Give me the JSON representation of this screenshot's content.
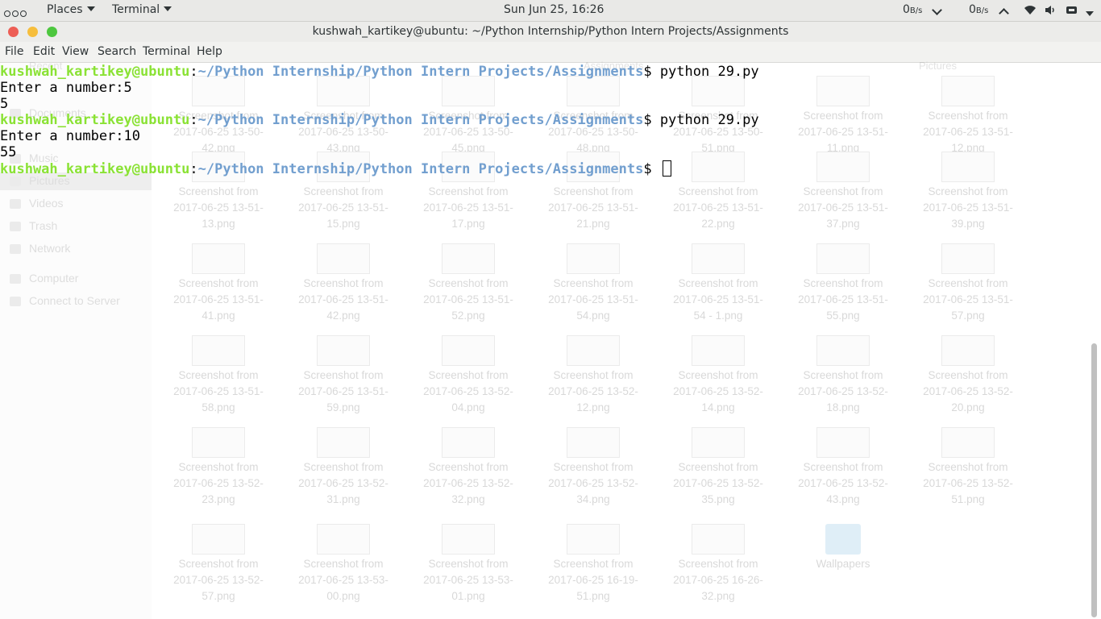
{
  "topbar": {
    "places_label": "Places",
    "terminal_label": "Terminal",
    "clock": "Sun Jun 25, 16:26",
    "net_down": "0",
    "net_down_unit": "B/s",
    "net_up": "0",
    "net_up_unit": "B/s"
  },
  "window": {
    "title": "kushwah_kartikey@ubuntu: ~/Python Internship/Python Intern Projects/Assignments"
  },
  "menu": [
    "File",
    "Edit",
    "View",
    "Search",
    "Terminal",
    "Help"
  ],
  "terminal": {
    "user": "kushwah_kartikey@ubuntu",
    "sep": ":",
    "path": "~/Python Internship/Python Intern Projects/Assignments",
    "prompt_suffix": "$ ",
    "lines": [
      {
        "type": "prompt",
        "cmd": "python 29.py"
      },
      {
        "type": "out",
        "text": "Enter a number:5"
      },
      {
        "type": "out",
        "text": "5"
      },
      {
        "type": "prompt",
        "cmd": "python 29.py"
      },
      {
        "type": "out",
        "text": "Enter a number:10"
      },
      {
        "type": "out",
        "text": "55"
      },
      {
        "type": "prompt",
        "cmd": ""
      }
    ]
  },
  "background_window": {
    "tabs": [
      "Recent",
      "Assignments",
      "Pictures"
    ],
    "sidebar": [
      "Documents",
      "Music",
      "Pictures",
      "Videos",
      "Trash",
      "Network",
      "Computer",
      "Connect to Server"
    ],
    "files": [
      [
        "Screenshot from",
        "2017-06-25 13-50-",
        "42.png"
      ],
      [
        "Screenshot from",
        "2017-06-25 13-50-",
        "43.png"
      ],
      [
        "Screenshot from",
        "2017-06-25 13-50-",
        "45.png"
      ],
      [
        "Screenshot from",
        "2017-06-25 13-50-",
        "48.png"
      ],
      [
        "Screenshot from",
        "2017-06-25 13-50-",
        "51.png"
      ],
      [
        "Screenshot from",
        "2017-06-25 13-51-",
        "11.png"
      ],
      [
        "Screenshot from",
        "2017-06-25 13-51-",
        "12.png"
      ],
      [
        "Screenshot from",
        "2017-06-25 13-51-",
        "13.png"
      ],
      [
        "Screenshot from",
        "2017-06-25 13-51-",
        "15.png"
      ],
      [
        "Screenshot from",
        "2017-06-25 13-51-",
        "17.png"
      ],
      [
        "Screenshot from",
        "2017-06-25 13-51-",
        "21.png"
      ],
      [
        "Screenshot from",
        "2017-06-25 13-51-",
        "22.png"
      ],
      [
        "Screenshot from",
        "2017-06-25 13-51-",
        "37.png"
      ],
      [
        "Screenshot from",
        "2017-06-25 13-51-",
        "39.png"
      ],
      [
        "Screenshot from",
        "2017-06-25 13-51-",
        "41.png"
      ],
      [
        "Screenshot from",
        "2017-06-25 13-51-",
        "42.png"
      ],
      [
        "Screenshot from",
        "2017-06-25 13-51-",
        "52.png"
      ],
      [
        "Screenshot from",
        "2017-06-25 13-51-",
        "54.png"
      ],
      [
        "Screenshot from",
        "2017-06-25 13-51-",
        "54 - 1.png"
      ],
      [
        "Screenshot from",
        "2017-06-25 13-51-",
        "55.png"
      ],
      [
        "Screenshot from",
        "2017-06-25 13-51-",
        "57.png"
      ],
      [
        "Screenshot from",
        "2017-06-25 13-51-",
        "58.png"
      ],
      [
        "Screenshot from",
        "2017-06-25 13-51-",
        "59.png"
      ],
      [
        "Screenshot from",
        "2017-06-25 13-52-",
        "04.png"
      ],
      [
        "Screenshot from",
        "2017-06-25 13-52-",
        "12.png"
      ],
      [
        "Screenshot from",
        "2017-06-25 13-52-",
        "14.png"
      ],
      [
        "Screenshot from",
        "2017-06-25 13-52-",
        "18.png"
      ],
      [
        "Screenshot from",
        "2017-06-25 13-52-",
        "20.png"
      ],
      [
        "Screenshot from",
        "2017-06-25 13-52-",
        "23.png"
      ],
      [
        "Screenshot from",
        "2017-06-25 13-52-",
        "31.png"
      ],
      [
        "Screenshot from",
        "2017-06-25 13-52-",
        "32.png"
      ],
      [
        "Screenshot from",
        "2017-06-25 13-52-",
        "34.png"
      ],
      [
        "Screenshot from",
        "2017-06-25 13-52-",
        "35.png"
      ],
      [
        "Screenshot from",
        "2017-06-25 13-52-",
        "43.png"
      ],
      [
        "Screenshot from",
        "2017-06-25 13-52-",
        "51.png"
      ],
      [
        "Screenshot from",
        "2017-06-25 13-52-",
        "57.png"
      ],
      [
        "Screenshot from",
        "2017-06-25 13-53-",
        "00.png"
      ],
      [
        "Screenshot from",
        "2017-06-25 13-53-",
        "01.png"
      ],
      [
        "Screenshot from",
        "2017-06-25 16-19-",
        "51.png"
      ],
      [
        "Screenshot from",
        "2017-06-25 16-26-",
        "32.png"
      ],
      [
        "Wallpapers"
      ]
    ]
  },
  "colors": {
    "prompt_user": "#8ae234",
    "prompt_path": "#729fcf",
    "close": "#ed5e55",
    "minimize": "#f6be3c",
    "maximize": "#4dc73f"
  }
}
